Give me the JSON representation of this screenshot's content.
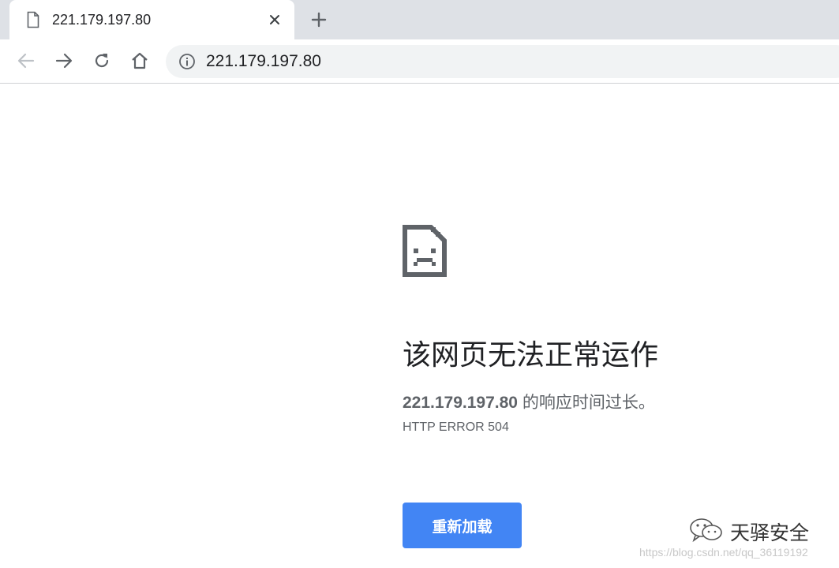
{
  "tab": {
    "title": "221.179.197.80",
    "favicon_icon": "page-icon",
    "close_icon": "close-icon"
  },
  "newtab_icon": "plus-icon",
  "toolbar": {
    "back_icon": "back-arrow-icon",
    "forward_icon": "forward-arrow-icon",
    "reload_icon": "reload-icon",
    "home_icon": "home-icon"
  },
  "omnibox": {
    "info_icon": "info-icon",
    "url": "221.179.197.80"
  },
  "error": {
    "icon": "sad-page-icon",
    "title": "该网页无法正常运作",
    "host": "221.179.197.80",
    "detail_suffix": " 的响应时间过长。",
    "code": "HTTP ERROR 504",
    "reload_label": "重新加载"
  },
  "watermark": {
    "icon": "wechat-icon",
    "name": "天驿安全",
    "url": "https://blog.csdn.net/qq_36119192"
  },
  "colors": {
    "tabstrip_bg": "#dee1e6",
    "omnibox_bg": "#f1f3f4",
    "button_blue": "#4285f4",
    "text_dark": "#202124",
    "text_gray": "#5f6368"
  }
}
